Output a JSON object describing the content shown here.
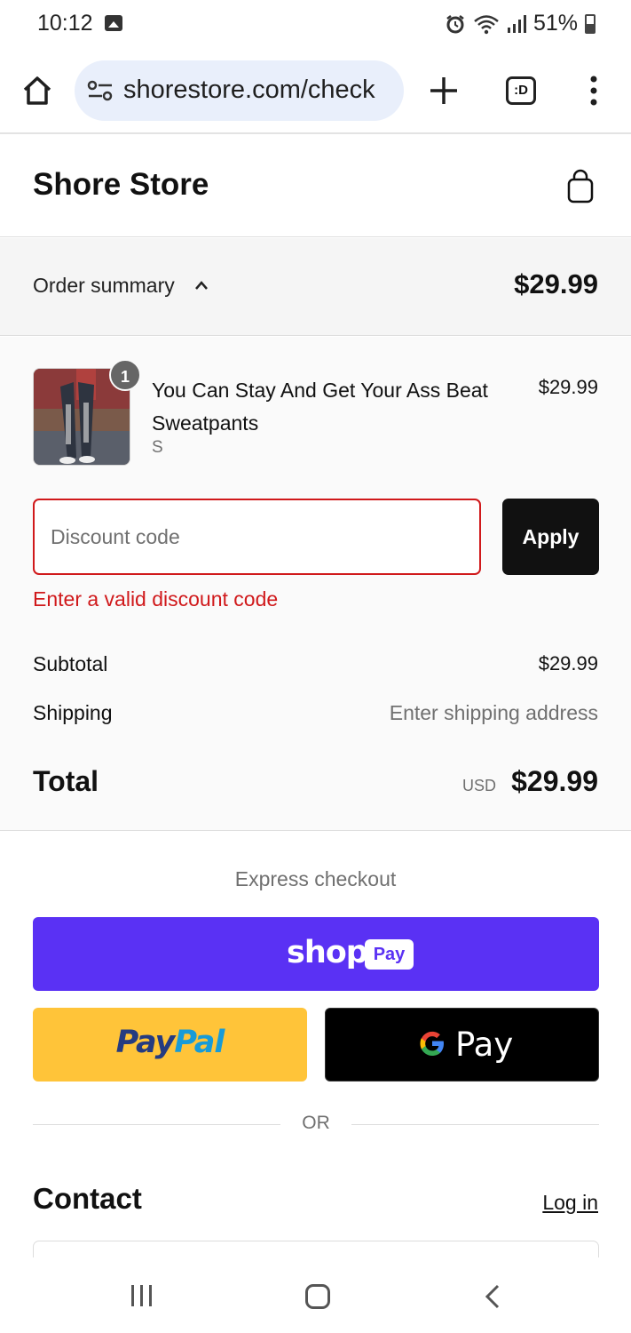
{
  "status_bar": {
    "time": "10:12",
    "battery": "51%",
    "icons": [
      "image-icon",
      "alarm-icon",
      "wifi-icon",
      "signal-icon",
      "battery-icon"
    ]
  },
  "browser": {
    "url": "shorestore.com/check",
    "tabs_label": ":D",
    "icons": [
      "home-icon",
      "site-settings-icon",
      "plus-icon",
      "tabs-icon",
      "more-vert-icon"
    ]
  },
  "store": {
    "title": "Shore Store",
    "cart_icon": "shopping-bag-icon"
  },
  "order_summary": {
    "label": "Order summary",
    "total": "$29.99",
    "item": {
      "quantity": "1",
      "name": "You Can Stay And Get Your Ass Beat Sweatpants",
      "variant": "S",
      "price": "$29.99"
    },
    "discount": {
      "placeholder": "Discount code",
      "value": "",
      "apply_label": "Apply",
      "error": "Enter a valid discount code"
    },
    "subtotal_label": "Subtotal",
    "subtotal_value": "$29.99",
    "shipping_label": "Shipping",
    "shipping_value": "Enter shipping address",
    "total_label": "Total",
    "total_currency": "USD",
    "total_value": "$29.99"
  },
  "express": {
    "title": "Express checkout",
    "shop_pay": {
      "logo": "shop",
      "badge": "Pay"
    },
    "paypal": {
      "part1": "Pay",
      "part2": "Pal"
    },
    "gpay": {
      "text": "Pay"
    },
    "or": "OR"
  },
  "contact": {
    "title": "Contact",
    "login": "Log in"
  },
  "colors": {
    "shop_pay": "#5a31f4",
    "paypal": "#ffc439",
    "error": "#d0191b",
    "button_dark": "#111111"
  }
}
